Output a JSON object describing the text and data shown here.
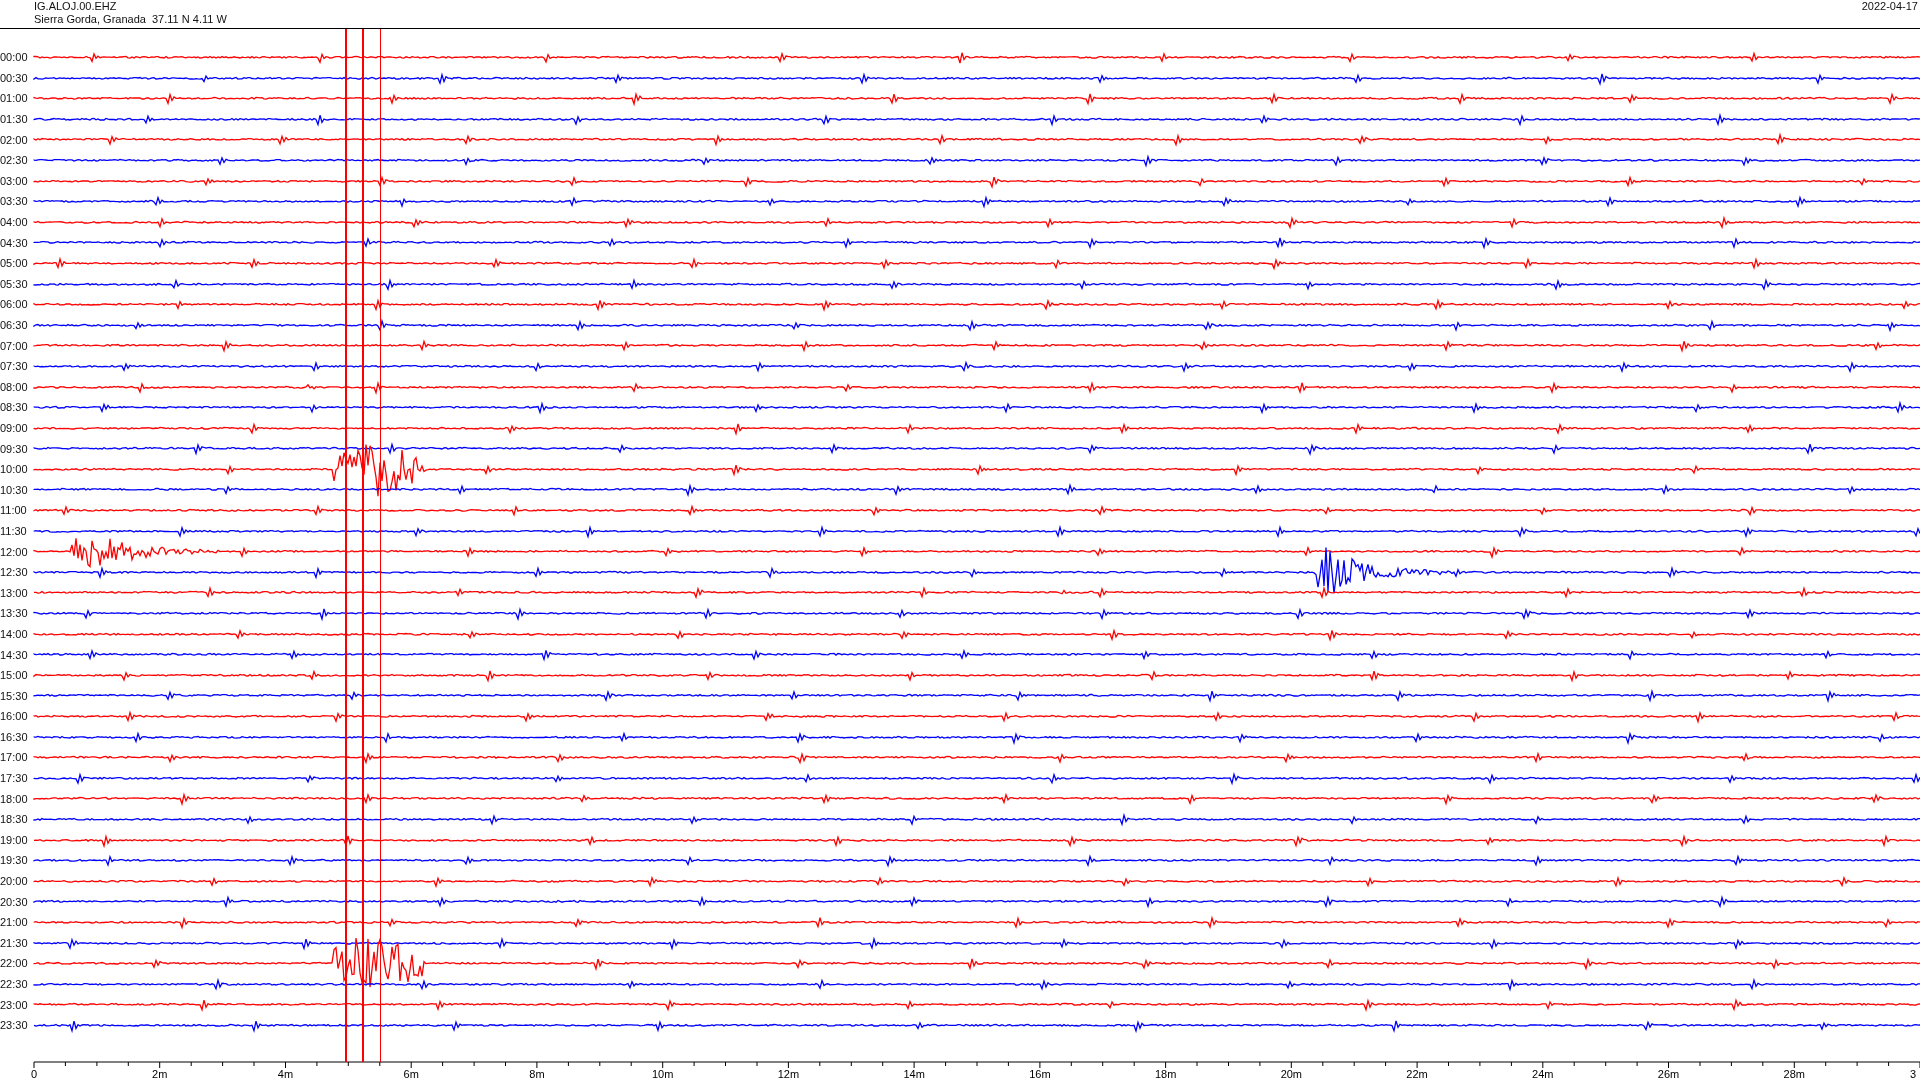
{
  "header": {
    "station": "IG.ALOJ.00.EHZ",
    "location": "Sierra Gorda, Granada  37.11 N 4.11 W",
    "date": "2022-04-17"
  },
  "rows": [
    {
      "time": "00:00",
      "color": "#ff0000"
    },
    {
      "time": "00:30",
      "color": "#0000ff"
    },
    {
      "time": "01:00",
      "color": "#ff0000"
    },
    {
      "time": "01:30",
      "color": "#0000ff"
    },
    {
      "time": "02:00",
      "color": "#ff0000"
    },
    {
      "time": "02:30",
      "color": "#0000ff"
    },
    {
      "time": "03:00",
      "color": "#ff0000"
    },
    {
      "time": "03:30",
      "color": "#0000ff"
    },
    {
      "time": "04:00",
      "color": "#ff0000"
    },
    {
      "time": "04:30",
      "color": "#0000ff"
    },
    {
      "time": "05:00",
      "color": "#ff0000"
    },
    {
      "time": "05:30",
      "color": "#0000ff"
    },
    {
      "time": "06:00",
      "color": "#ff0000"
    },
    {
      "time": "06:30",
      "color": "#0000ff"
    },
    {
      "time": "07:00",
      "color": "#ff0000"
    },
    {
      "time": "07:30",
      "color": "#0000ff"
    },
    {
      "time": "08:00",
      "color": "#ff0000"
    },
    {
      "time": "08:30",
      "color": "#0000ff"
    },
    {
      "time": "09:00",
      "color": "#ff0000"
    },
    {
      "time": "09:30",
      "color": "#0000ff"
    },
    {
      "time": "10:00",
      "color": "#ff0000"
    },
    {
      "time": "10:30",
      "color": "#0000ff"
    },
    {
      "time": "11:00",
      "color": "#ff0000"
    },
    {
      "time": "11:30",
      "color": "#0000ff"
    },
    {
      "time": "12:00",
      "color": "#ff0000"
    },
    {
      "time": "12:30",
      "color": "#0000ff"
    },
    {
      "time": "13:00",
      "color": "#ff0000"
    },
    {
      "time": "13:30",
      "color": "#0000ff"
    },
    {
      "time": "14:00",
      "color": "#ff0000"
    },
    {
      "time": "14:30",
      "color": "#0000ff"
    },
    {
      "time": "15:00",
      "color": "#ff0000"
    },
    {
      "time": "15:30",
      "color": "#0000ff"
    },
    {
      "time": "16:00",
      "color": "#ff0000"
    },
    {
      "time": "16:30",
      "color": "#0000ff"
    },
    {
      "time": "17:00",
      "color": "#ff0000"
    },
    {
      "time": "17:30",
      "color": "#0000ff"
    },
    {
      "time": "18:00",
      "color": "#ff0000"
    },
    {
      "time": "18:30",
      "color": "#0000ff"
    },
    {
      "time": "19:00",
      "color": "#ff0000"
    },
    {
      "time": "19:30",
      "color": "#0000ff"
    },
    {
      "time": "20:00",
      "color": "#ff0000"
    },
    {
      "time": "20:30",
      "color": "#0000ff"
    },
    {
      "time": "21:00",
      "color": "#ff0000"
    },
    {
      "time": "21:30",
      "color": "#0000ff"
    },
    {
      "time": "22:00",
      "color": "#ff0000"
    },
    {
      "time": "22:30",
      "color": "#0000ff"
    },
    {
      "time": "23:00",
      "color": "#ff0000"
    },
    {
      "time": "23:30",
      "color": "#0000ff"
    }
  ],
  "x_axis": {
    "ticks": [
      "0",
      "2m",
      "4m",
      "6m",
      "8m",
      "10m",
      "12m",
      "14m",
      "16m",
      "18m",
      "20m",
      "22m",
      "24m",
      "26m",
      "28m",
      "3"
    ]
  }
}
